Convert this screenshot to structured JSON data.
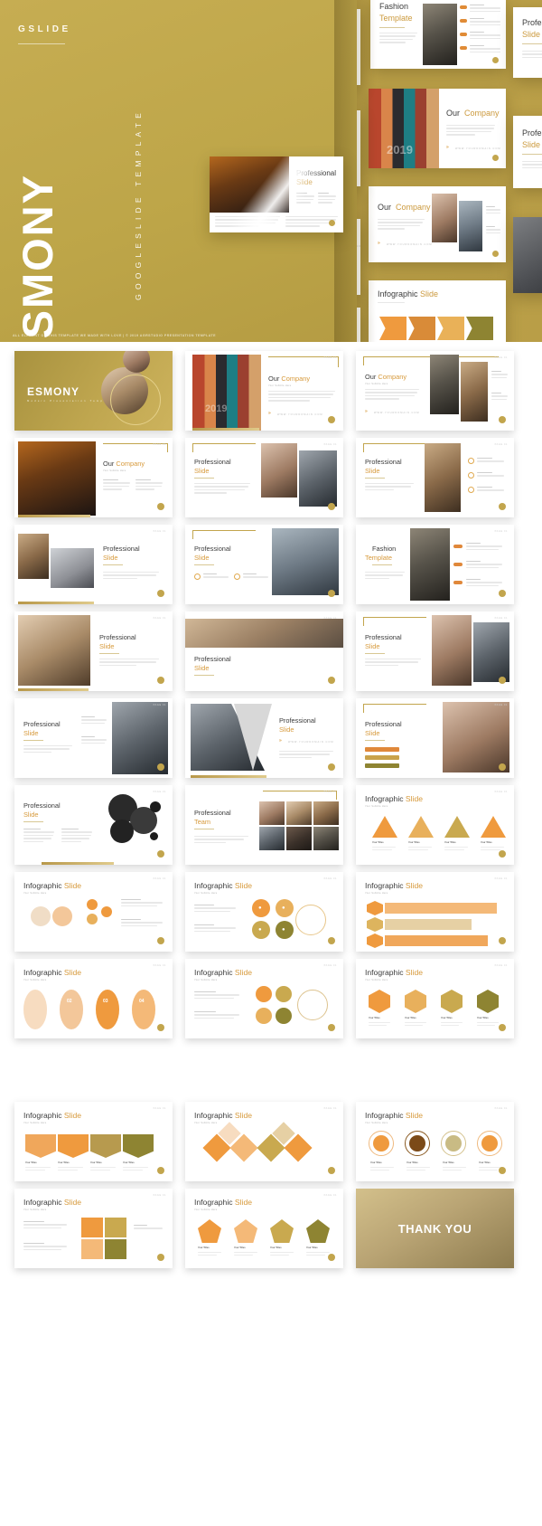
{
  "hero": {
    "brand": "GSLIDE",
    "title": "ESMONY",
    "subtitle": "GOOGLESLIDE TEMPLATE",
    "footnote": "ALL ELEMENT ON THIS TEMPLATE WE MADE WITH LOVE | © 2019 AGRSTUDIO PRESENTATION TEMPLATE",
    "colors": {
      "gold": "#c2a84c",
      "gold_dark": "#b59c43",
      "accent_orange": "#d79a3c",
      "white": "#ffffff"
    },
    "mockups": [
      {
        "title_line1": "Professional",
        "title_line2": "Slide"
      },
      {
        "title_line1": "Professional",
        "title_line2": "Slide"
      },
      {
        "title_line1": "Our",
        "title_line2": "Company"
      },
      {
        "title_line1": "Professional",
        "title_line2": "Slide"
      },
      {
        "title_line1": "Fashion",
        "title_line2": "Template"
      },
      {
        "title_line1": "Our",
        "title_line2": "Company"
      },
      {
        "title_line1": "Our",
        "title_line2": "Company"
      },
      {
        "title_line1": "Infographic",
        "title_line2": "Slide"
      },
      {
        "title_line1": "Professional",
        "title_line2": "Slide"
      },
      {
        "title_line1": "Professional",
        "title_line2": "Slide"
      }
    ],
    "mock_url": "WWW.YOURDOMAIN.COM",
    "year_watermark": "2019"
  },
  "common": {
    "your_title": "Your Title",
    "your_titles": "Your Titles",
    "url": "WWW.YOURDOMAIN.COM",
    "slide_number": "PAGE 01",
    "body_placeholder": "Lorem ipsum dolor sit amet consectetur adipiscing elit sed do eiusmod tempor incididunt ut labore et dolore magna aliqua."
  },
  "slides": [
    {
      "row": 1,
      "col": 0,
      "kind": "cover",
      "title1": "ESMONY",
      "title2": "",
      "sub": "Modern Presentation Template"
    },
    {
      "row": 1,
      "col": 1,
      "kind": "image-left",
      "title1": "Our",
      "title2": "Company",
      "sub": "Your Subtitle Here",
      "watermark": "2019"
    },
    {
      "row": 1,
      "col": 2,
      "kind": "image-right",
      "title1": "Our",
      "title2": "Company",
      "sub": "Your Subtitle Here"
    },
    {
      "row": 2,
      "col": 0,
      "kind": "image-left",
      "title1": "Our",
      "title2": "Company",
      "sub": "Your Subtitle Here"
    },
    {
      "row": 2,
      "col": 1,
      "kind": "image-right",
      "title1": "Professional",
      "title2": "Slide",
      "sub": "Your Subtitle Here"
    },
    {
      "row": 2,
      "col": 2,
      "kind": "icon-list",
      "title1": "Professional",
      "title2": "Slide",
      "sub": "Your Subtitle Here"
    },
    {
      "row": 3,
      "col": 0,
      "kind": "image-left",
      "title1": "Professional",
      "title2": "Slide",
      "sub": "Your Subtitle Here"
    },
    {
      "row": 3,
      "col": 1,
      "kind": "image-right",
      "title1": "Professional",
      "title2": "Slide",
      "sub": "Your Subtitle Here"
    },
    {
      "row": 3,
      "col": 2,
      "kind": "fashion",
      "title1": "Fashion",
      "title2": "Template",
      "sub": "Your Subtitle Here"
    },
    {
      "row": 4,
      "col": 0,
      "kind": "image-left",
      "title1": "Professional",
      "title2": "Slide",
      "sub": "Your Subtitle Here"
    },
    {
      "row": 4,
      "col": 1,
      "kind": "image-band",
      "title1": "Professional",
      "title2": "Slide",
      "sub": "Your Subtitle Here"
    },
    {
      "row": 4,
      "col": 2,
      "kind": "image-right",
      "title1": "Professional",
      "title2": "Slide",
      "sub": "Your Subtitle Here"
    },
    {
      "row": 5,
      "col": 0,
      "kind": "image-right",
      "title1": "Professional",
      "title2": "Slide",
      "sub": "Your Subtitle Here"
    },
    {
      "row": 5,
      "col": 1,
      "kind": "triangles",
      "title1": "Professional",
      "title2": "Slide",
      "sub": "Your Subtitle Here"
    },
    {
      "row": 5,
      "col": 2,
      "kind": "image-right",
      "title1": "Professional",
      "title2": "Slide",
      "sub": "Your Subtitle Here"
    },
    {
      "row": 6,
      "col": 0,
      "kind": "bubbles",
      "title1": "Professional",
      "title2": "Slide",
      "sub": "Your Subtitle Here"
    },
    {
      "row": 6,
      "col": 1,
      "kind": "team",
      "title1": "Professional",
      "title2": "Team",
      "sub": "Your Subtitle Here"
    },
    {
      "row": 6,
      "col": 2,
      "kind": "ig-triangles",
      "title1": "Infographic",
      "title2": "Slide",
      "sub": "Your Subtitle Here"
    },
    {
      "row": 7,
      "col": 0,
      "kind": "ig-circles",
      "title1": "Infographic",
      "title2": "Slide",
      "sub": "Your Subtitle Here"
    },
    {
      "row": 7,
      "col": 1,
      "kind": "ig-coins",
      "title1": "Infographic",
      "title2": "Slide",
      "sub": "Your Subtitle Here"
    },
    {
      "row": 7,
      "col": 2,
      "kind": "ig-bars",
      "title1": "Infographic",
      "title2": "Slide",
      "sub": "Your Subtitle Here"
    },
    {
      "row": 8,
      "col": 0,
      "kind": "ig-steps",
      "title1": "Infographic",
      "title2": "Slide",
      "sub": "Your Subtitle Here"
    },
    {
      "row": 8,
      "col": 1,
      "kind": "ig-hexmix",
      "title1": "Infographic",
      "title2": "Slide",
      "sub": "Your Subtitle Here"
    },
    {
      "row": 8,
      "col": 2,
      "kind": "ig-hexrow",
      "title1": "Infographic",
      "title2": "Slide",
      "sub": "Your Subtitle Here"
    },
    {
      "row": 9,
      "col": 0,
      "kind": "ig-pinrow",
      "title1": "Infographic",
      "title2": "Slide",
      "sub": "Your Subtitle Here"
    },
    {
      "row": 9,
      "col": 1,
      "kind": "ig-diamonds",
      "title1": "Infographic",
      "title2": "Slide",
      "sub": "Your Subtitle Here"
    },
    {
      "row": 9,
      "col": 2,
      "kind": "ig-rings",
      "title1": "Infographic",
      "title2": "Slide",
      "sub": "Your Subtitle Here"
    },
    {
      "row": 10,
      "col": 0,
      "kind": "ig-squares",
      "title1": "Infographic",
      "title2": "Slide",
      "sub": "Your Subtitle Here"
    },
    {
      "row": 10,
      "col": 1,
      "kind": "ig-pents",
      "title1": "Infographic",
      "title2": "Slide",
      "sub": "Your Subtitle Here"
    },
    {
      "row": 10,
      "col": 2,
      "kind": "thanks",
      "title1": "THANK YOU",
      "title2": "",
      "sub": ""
    }
  ],
  "infographic_steps": [
    "01",
    "02",
    "03",
    "04"
  ],
  "step_numbers_visible": [
    "02",
    "03",
    "04"
  ]
}
